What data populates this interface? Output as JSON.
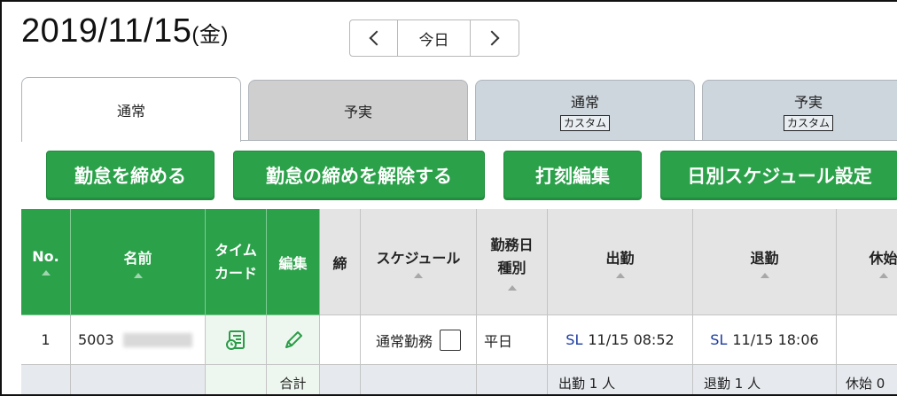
{
  "header": {
    "date": "2019/11/15",
    "weekday": "(金)",
    "nav_today": "今日"
  },
  "tabs": [
    {
      "label": "通常",
      "custom": ""
    },
    {
      "label": "予実",
      "custom": ""
    },
    {
      "label": "通常",
      "custom": "カスタム"
    },
    {
      "label": "予実",
      "custom": "カスタム"
    }
  ],
  "actions": {
    "close_attendance": "勤怠を締める",
    "release_close": "勤怠の締めを解除する",
    "edit_punch": "打刻編集",
    "daily_schedule": "日別スケジュール設定"
  },
  "table": {
    "headers": {
      "no": "No.",
      "name": "名前",
      "timecard_l1": "タイム",
      "timecard_l2": "カード",
      "edit": "編集",
      "closed": "締",
      "schedule": "スケジュール",
      "daytype_l1": "勤務日",
      "daytype_l2": "種別",
      "clock_in": "出勤",
      "clock_out": "退勤",
      "break": "休始"
    },
    "rows": [
      {
        "no": "1",
        "name": "5003",
        "schedule": "通常勤務",
        "day_type": "平日",
        "in_tag": "SL",
        "in_time": "11/15 08:52",
        "out_tag": "SL",
        "out_time": "11/15 18:06"
      }
    ],
    "summary": {
      "label": "合計",
      "clock_in": "出勤 1 人",
      "clock_out": "退勤 1 人",
      "break": "休始 0"
    }
  },
  "colors": {
    "accent_green": "#2ba14a",
    "header_gray": "#e4e4e4",
    "link_blue": "#1a3aa0"
  }
}
